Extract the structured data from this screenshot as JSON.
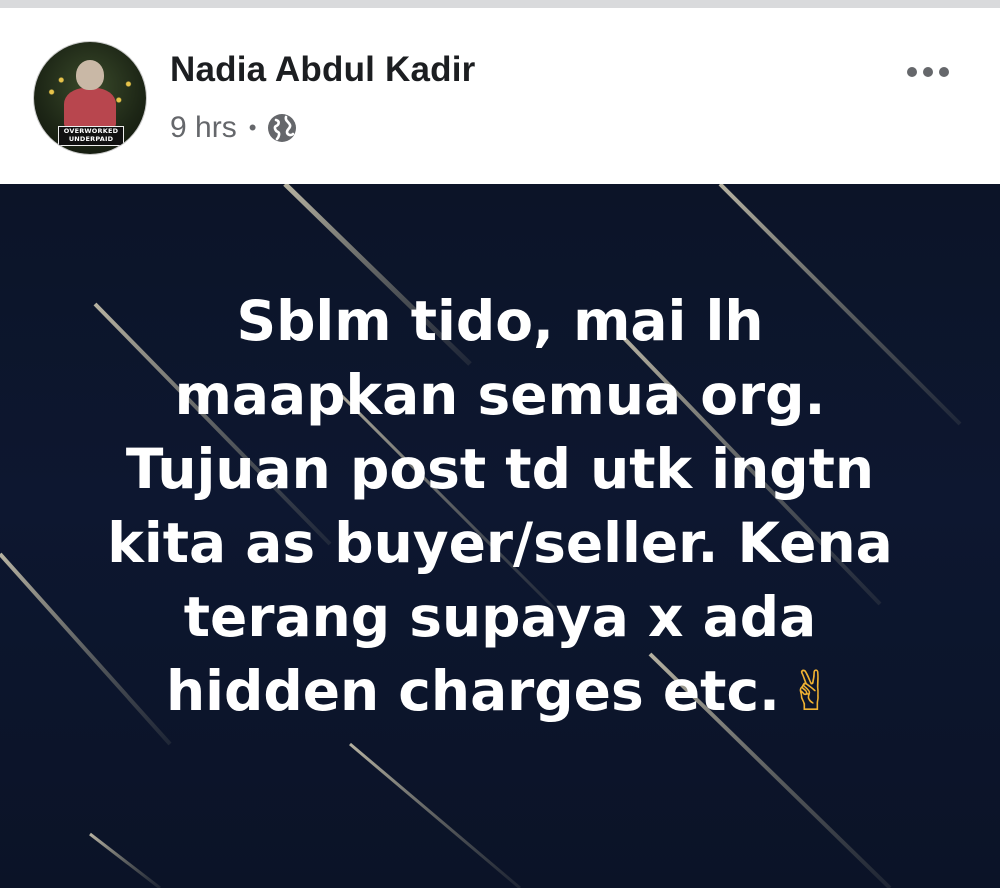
{
  "post": {
    "author": {
      "name": "Nadia Abdul Kadir",
      "avatar_banner_line1": "OVERWORKED",
      "avatar_banner_line2": "UNDERPAID"
    },
    "time": "9 hrs",
    "separator": "•",
    "audience_icon": "globe-icon",
    "more_icon": "more-options-icon",
    "content": {
      "lines": [
        "Sblm tido, mai lh",
        "maapkan semua org.",
        "Tujuan post td utk ingtn",
        "kita as buyer/seller. Kena",
        "terang supaya x ada",
        "hidden charges etc."
      ],
      "emoji": "✌",
      "emoji_name": "victory-hand-icon"
    }
  },
  "colors": {
    "background_dark": "#0d1730",
    "text_white": "#ffffff",
    "meta_gray": "#65676b",
    "name_black": "#1c1e21"
  }
}
